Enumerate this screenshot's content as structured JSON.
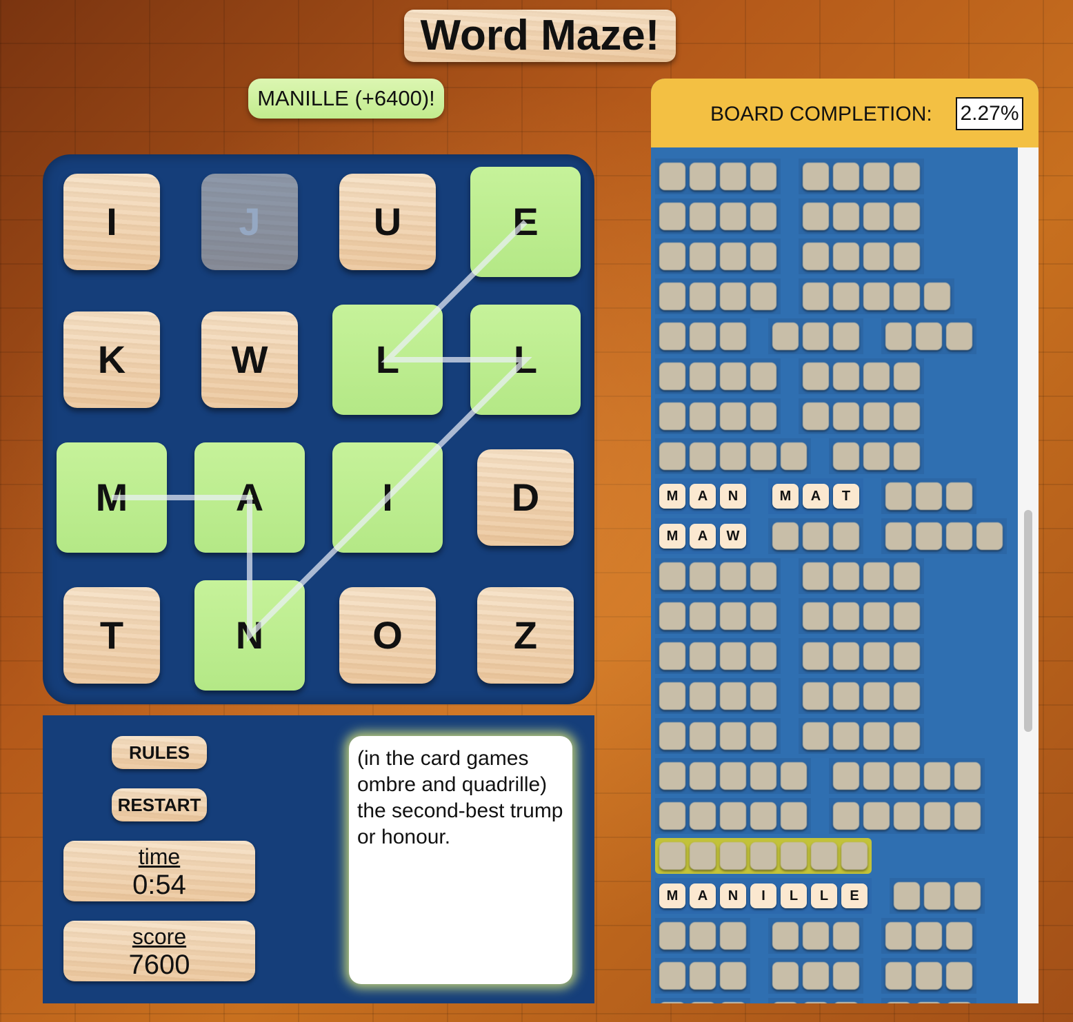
{
  "header": {
    "title": "Word Maze!"
  },
  "toast": {
    "text": "MANILLE (+6400)!"
  },
  "board": {
    "tiles": [
      {
        "letter": "I",
        "state": "normal"
      },
      {
        "letter": "J",
        "state": "used"
      },
      {
        "letter": "U",
        "state": "normal"
      },
      {
        "letter": "E",
        "state": "selected"
      },
      {
        "letter": "K",
        "state": "normal"
      },
      {
        "letter": "W",
        "state": "normal"
      },
      {
        "letter": "L",
        "state": "selected"
      },
      {
        "letter": "L",
        "state": "selected"
      },
      {
        "letter": "M",
        "state": "selected"
      },
      {
        "letter": "A",
        "state": "selected"
      },
      {
        "letter": "I",
        "state": "selected"
      },
      {
        "letter": "D",
        "state": "normal"
      },
      {
        "letter": "T",
        "state": "normal"
      },
      {
        "letter": "N",
        "state": "selected"
      },
      {
        "letter": "O",
        "state": "normal"
      },
      {
        "letter": "Z",
        "state": "normal"
      }
    ],
    "path_tile_indices": [
      8,
      9,
      13,
      10,
      7,
      6,
      3
    ]
  },
  "controls": {
    "rules_label": "RULES",
    "restart_label": "RESTART",
    "time_label": "time",
    "time_value": "0:54",
    "score_label": "score",
    "score_value": "7600"
  },
  "definition": {
    "text": "(in the card games ombre and quadrille) the second-best trump or honour."
  },
  "completion": {
    "label": "BOARD COMPLETION:",
    "value": "2.27%"
  },
  "word_list": {
    "rows": [
      {
        "groups": [
          {
            "len": 4
          },
          {
            "len": 4
          }
        ]
      },
      {
        "groups": [
          {
            "len": 4
          },
          {
            "len": 4
          }
        ]
      },
      {
        "groups": [
          {
            "len": 4
          },
          {
            "len": 4
          }
        ]
      },
      {
        "groups": [
          {
            "len": 4
          },
          {
            "len": 5
          }
        ]
      },
      {
        "groups": [
          {
            "len": 3
          },
          {
            "len": 3
          },
          {
            "len": 3
          }
        ]
      },
      {
        "groups": [
          {
            "len": 4
          },
          {
            "len": 4
          }
        ]
      },
      {
        "groups": [
          {
            "len": 4
          },
          {
            "len": 4
          }
        ]
      },
      {
        "groups": [
          {
            "len": 5
          },
          {
            "len": 3
          }
        ]
      },
      {
        "groups": [
          {
            "len": 3,
            "word": "MAN"
          },
          {
            "len": 3,
            "word": "MAT"
          },
          {
            "len": 3
          }
        ]
      },
      {
        "groups": [
          {
            "len": 3,
            "word": "MAW"
          },
          {
            "len": 3
          },
          {
            "len": 4
          }
        ]
      },
      {
        "groups": [
          {
            "len": 4
          },
          {
            "len": 4
          }
        ]
      },
      {
        "groups": [
          {
            "len": 4
          },
          {
            "len": 4
          }
        ]
      },
      {
        "groups": [
          {
            "len": 4
          },
          {
            "len": 4
          }
        ]
      },
      {
        "groups": [
          {
            "len": 4
          },
          {
            "len": 4
          }
        ]
      },
      {
        "groups": [
          {
            "len": 4
          },
          {
            "len": 4
          }
        ]
      },
      {
        "groups": [
          {
            "len": 5
          },
          {
            "len": 5
          }
        ]
      },
      {
        "groups": [
          {
            "len": 5
          },
          {
            "len": 5
          }
        ]
      },
      {
        "groups": [
          {
            "len": 7,
            "highlight": true
          }
        ]
      },
      {
        "groups": [
          {
            "len": 7,
            "word": "MANILLE"
          },
          {
            "len": 3
          }
        ]
      },
      {
        "groups": [
          {
            "len": 3
          },
          {
            "len": 3
          },
          {
            "len": 3
          }
        ]
      },
      {
        "groups": [
          {
            "len": 3
          },
          {
            "len": 3
          },
          {
            "len": 3
          }
        ]
      },
      {
        "groups": [
          {
            "len": 3
          },
          {
            "len": 3
          },
          {
            "len": 3
          }
        ]
      }
    ]
  }
}
